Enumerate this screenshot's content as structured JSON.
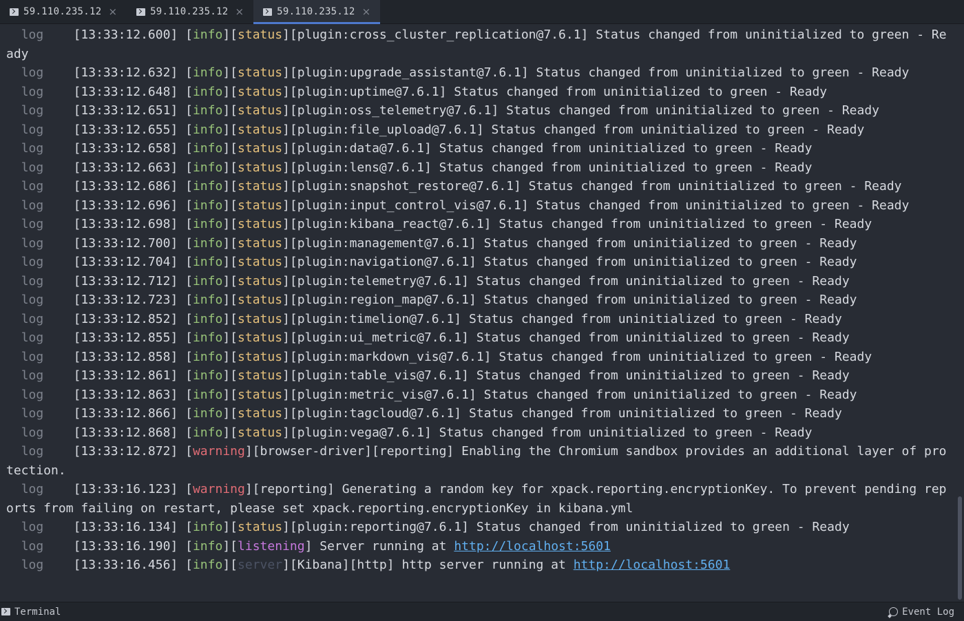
{
  "tabs": [
    {
      "label": "59.110.235.12",
      "active": false
    },
    {
      "label": "59.110.235.12",
      "active": false
    },
    {
      "label": "59.110.235.12",
      "active": true
    }
  ],
  "log_lines": [
    {
      "ts": "[13:33:12.600]",
      "level": "info",
      "tags": [
        {
          "text": "status",
          "kind": "status"
        }
      ],
      "rest": "[plugin:cross_cluster_replication@7.6.1] Status changed from uninitialized to green - Ready"
    },
    {
      "ts": "[13:33:12.632]",
      "level": "info",
      "tags": [
        {
          "text": "status",
          "kind": "status"
        }
      ],
      "rest": "[plugin:upgrade_assistant@7.6.1] Status changed from uninitialized to green - Ready"
    },
    {
      "ts": "[13:33:12.648]",
      "level": "info",
      "tags": [
        {
          "text": "status",
          "kind": "status"
        }
      ],
      "rest": "[plugin:uptime@7.6.1] Status changed from uninitialized to green - Ready"
    },
    {
      "ts": "[13:33:12.651]",
      "level": "info",
      "tags": [
        {
          "text": "status",
          "kind": "status"
        }
      ],
      "rest": "[plugin:oss_telemetry@7.6.1] Status changed from uninitialized to green - Ready"
    },
    {
      "ts": "[13:33:12.655]",
      "level": "info",
      "tags": [
        {
          "text": "status",
          "kind": "status"
        }
      ],
      "rest": "[plugin:file_upload@7.6.1] Status changed from uninitialized to green - Ready"
    },
    {
      "ts": "[13:33:12.658]",
      "level": "info",
      "tags": [
        {
          "text": "status",
          "kind": "status"
        }
      ],
      "rest": "[plugin:data@7.6.1] Status changed from uninitialized to green - Ready"
    },
    {
      "ts": "[13:33:12.663]",
      "level": "info",
      "tags": [
        {
          "text": "status",
          "kind": "status"
        }
      ],
      "rest": "[plugin:lens@7.6.1] Status changed from uninitialized to green - Ready"
    },
    {
      "ts": "[13:33:12.686]",
      "level": "info",
      "tags": [
        {
          "text": "status",
          "kind": "status"
        }
      ],
      "rest": "[plugin:snapshot_restore@7.6.1] Status changed from uninitialized to green - Ready"
    },
    {
      "ts": "[13:33:12.696]",
      "level": "info",
      "tags": [
        {
          "text": "status",
          "kind": "status"
        }
      ],
      "rest": "[plugin:input_control_vis@7.6.1] Status changed from uninitialized to green - Ready"
    },
    {
      "ts": "[13:33:12.698]",
      "level": "info",
      "tags": [
        {
          "text": "status",
          "kind": "status"
        }
      ],
      "rest": "[plugin:kibana_react@7.6.1] Status changed from uninitialized to green - Ready"
    },
    {
      "ts": "[13:33:12.700]",
      "level": "info",
      "tags": [
        {
          "text": "status",
          "kind": "status"
        }
      ],
      "rest": "[plugin:management@7.6.1] Status changed from uninitialized to green - Ready"
    },
    {
      "ts": "[13:33:12.704]",
      "level": "info",
      "tags": [
        {
          "text": "status",
          "kind": "status"
        }
      ],
      "rest": "[plugin:navigation@7.6.1] Status changed from uninitialized to green - Ready"
    },
    {
      "ts": "[13:33:12.712]",
      "level": "info",
      "tags": [
        {
          "text": "status",
          "kind": "status"
        }
      ],
      "rest": "[plugin:telemetry@7.6.1] Status changed from uninitialized to green - Ready"
    },
    {
      "ts": "[13:33:12.723]",
      "level": "info",
      "tags": [
        {
          "text": "status",
          "kind": "status"
        }
      ],
      "rest": "[plugin:region_map@7.6.1] Status changed from uninitialized to green - Ready"
    },
    {
      "ts": "[13:33:12.852]",
      "level": "info",
      "tags": [
        {
          "text": "status",
          "kind": "status"
        }
      ],
      "rest": "[plugin:timelion@7.6.1] Status changed from uninitialized to green - Ready"
    },
    {
      "ts": "[13:33:12.855]",
      "level": "info",
      "tags": [
        {
          "text": "status",
          "kind": "status"
        }
      ],
      "rest": "[plugin:ui_metric@7.6.1] Status changed from uninitialized to green - Ready"
    },
    {
      "ts": "[13:33:12.858]",
      "level": "info",
      "tags": [
        {
          "text": "status",
          "kind": "status"
        }
      ],
      "rest": "[plugin:markdown_vis@7.6.1] Status changed from uninitialized to green - Ready"
    },
    {
      "ts": "[13:33:12.861]",
      "level": "info",
      "tags": [
        {
          "text": "status",
          "kind": "status"
        }
      ],
      "rest": "[plugin:table_vis@7.6.1] Status changed from uninitialized to green - Ready"
    },
    {
      "ts": "[13:33:12.863]",
      "level": "info",
      "tags": [
        {
          "text": "status",
          "kind": "status"
        }
      ],
      "rest": "[plugin:metric_vis@7.6.1] Status changed from uninitialized to green - Ready"
    },
    {
      "ts": "[13:33:12.866]",
      "level": "info",
      "tags": [
        {
          "text": "status",
          "kind": "status"
        }
      ],
      "rest": "[plugin:tagcloud@7.6.1] Status changed from uninitialized to green - Ready"
    },
    {
      "ts": "[13:33:12.868]",
      "level": "info",
      "tags": [
        {
          "text": "status",
          "kind": "status"
        }
      ],
      "rest": "[plugin:vega@7.6.1] Status changed from uninitialized to green - Ready"
    },
    {
      "ts": "[13:33:12.872]",
      "level": "warning",
      "tags": [],
      "rest": "[browser-driver][reporting] Enabling the Chromium sandbox provides an additional layer of protection."
    },
    {
      "ts": "[13:33:16.123]",
      "level": "warning",
      "tags": [],
      "rest": "[reporting] Generating a random key for xpack.reporting.encryptionKey. To prevent pending reports from failing on restart, please set xpack.reporting.encryptionKey in kibana.yml"
    },
    {
      "ts": "[13:33:16.134]",
      "level": "info",
      "tags": [
        {
          "text": "status",
          "kind": "status"
        }
      ],
      "rest": "[plugin:reporting@7.6.1] Status changed from uninitialized to green - Ready"
    },
    {
      "ts": "[13:33:16.190]",
      "level": "info",
      "tags": [
        {
          "text": "listening",
          "kind": "listening"
        }
      ],
      "rest": "Server running at ",
      "link": "http://localhost:5601"
    },
    {
      "ts": "[13:33:16.456]",
      "level": "info",
      "tags": [
        {
          "text": "server",
          "kind": "server"
        }
      ],
      "rest": "[Kibana][http] http server running at ",
      "link": "http://localhost:5601"
    }
  ],
  "log_prefix": "log",
  "statusbar": {
    "left_label": "Terminal",
    "right_label": "Event Log"
  }
}
